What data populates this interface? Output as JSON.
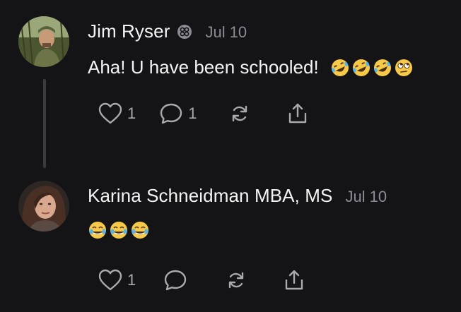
{
  "comments": [
    {
      "author": "Jim Ryser",
      "badge_icon": "verified-badge-icon",
      "date": "Jul 10",
      "text": "Aha! U have been schooled!",
      "emojis": [
        "rofl",
        "rofl",
        "rofl",
        "eye-roll"
      ],
      "likes": "1",
      "replies": "1"
    },
    {
      "author": "Karina Schneidman MBA, MS",
      "date": "Jul 10",
      "text": "",
      "emojis": [
        "tears-of-joy",
        "tears-of-joy",
        "tears-of-joy"
      ],
      "likes": "1",
      "replies": ""
    }
  ],
  "icons": {
    "like": "heart-icon",
    "reply": "comment-bubble-icon",
    "restack": "restack-icon",
    "share": "share-icon"
  },
  "colors": {
    "background": "#141416",
    "text": "#f4f4f4",
    "muted": "#8c8c92",
    "icon": "#a9a9ae",
    "emoji": "#f7c948"
  }
}
